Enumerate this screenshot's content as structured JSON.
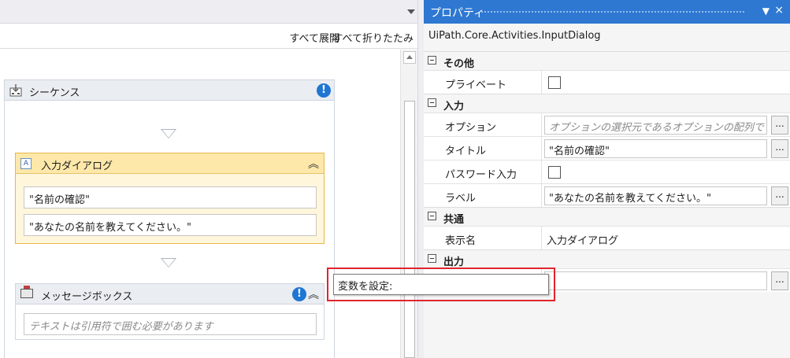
{
  "designer": {
    "expand_all": "すべて展開",
    "collapse_all": "すべて折りたたみ",
    "sequence": {
      "title": "シーケンス",
      "info_mark": "!"
    },
    "input_dialog": {
      "title": "入力ダイアログ",
      "chevron": "︽",
      "title_field": "\"名前の確認\"",
      "label_field": "\"あなたの名前を教えてください。\""
    },
    "message_box": {
      "title": "メッセージボックス",
      "chevron": "︽",
      "info_mark": "!",
      "text_placeholder": "テキストは引用符で囲む必要があります"
    }
  },
  "properties": {
    "panel_title": "プロパティ",
    "pin_icon": "▼",
    "close_icon": "×",
    "class_name": "UiPath.Core.Activities.InputDialog",
    "categories": {
      "misc": "その他",
      "input": "入力",
      "common": "共通",
      "output": "出力"
    },
    "rows": {
      "private": {
        "name": "プライベート"
      },
      "options": {
        "name": "オプション",
        "placeholder": "オプションの選択元であるオプションの配列です。"
      },
      "title": {
        "name": "タイトル",
        "value": "\"名前の確認\""
      },
      "password": {
        "name": "パスワード入力"
      },
      "label": {
        "name": "ラベル",
        "value": "\"あなたの名前を教えてください。\""
      },
      "display_name": {
        "name": "表示名",
        "value": "入力ダイアログ"
      },
      "result": {
        "value": ""
      }
    },
    "ellipsis": "..."
  },
  "popup": {
    "set_variable": "変数を設定:"
  },
  "colors": {
    "accent": "#2e78d2",
    "highlight": "#e0252d",
    "activity_selected": "#fff6dc",
    "info": "#1f76d3"
  }
}
